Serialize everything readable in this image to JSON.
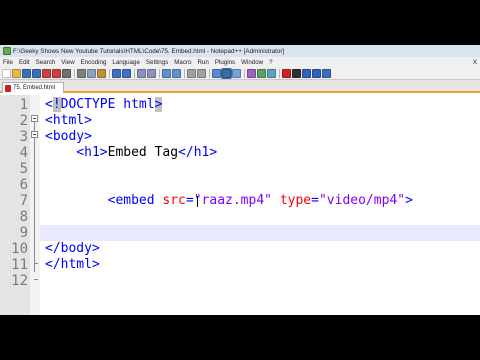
{
  "window": {
    "title": "F:\\Geeky Shows New Youtube Tutorials\\HTML\\Code\\75. Embed.html - Notepad++ [Administrator]"
  },
  "menu": {
    "items": [
      "File",
      "Edit",
      "Search",
      "View",
      "Encoding",
      "Language",
      "Settings",
      "Macro",
      "Run",
      "Plugins",
      "Window",
      "?"
    ],
    "close_label": "X"
  },
  "tabs": [
    {
      "label": "75. Embed.html",
      "active": true
    }
  ],
  "editor": {
    "current_line": 9,
    "lines": [
      {
        "num": "1",
        "parts": [
          {
            "t": "<",
            "c": "tag"
          },
          {
            "t": "!",
            "c": "tag-hl"
          },
          {
            "t": "DOCTYPE html",
            "c": "tag"
          },
          {
            "t": ">",
            "c": "tag-hl"
          }
        ]
      },
      {
        "num": "2",
        "parts": [
          {
            "t": "<html>",
            "c": "tag"
          }
        ]
      },
      {
        "num": "3",
        "parts": [
          {
            "t": "<body>",
            "c": "tag"
          }
        ]
      },
      {
        "num": "4",
        "parts": [
          {
            "t": "    <h1>",
            "c": "tag"
          },
          {
            "t": "Embed Tag",
            "c": "text"
          },
          {
            "t": "</h1>",
            "c": "tag"
          }
        ]
      },
      {
        "num": "5",
        "parts": []
      },
      {
        "num": "6",
        "parts": []
      },
      {
        "num": "7",
        "parts": [
          {
            "t": "        <embed ",
            "c": "tag"
          },
          {
            "t": "src",
            "c": "attr"
          },
          {
            "t": "=",
            "c": "tag"
          },
          {
            "t": "\"raaz.mp4\"",
            "c": "str"
          },
          {
            "t": " ",
            "c": "tag"
          },
          {
            "t": "type",
            "c": "attr"
          },
          {
            "t": "=",
            "c": "tag"
          },
          {
            "t": "\"video/mp4\"",
            "c": "str"
          },
          {
            "t": ">",
            "c": "tag"
          }
        ]
      },
      {
        "num": "8",
        "parts": []
      },
      {
        "num": "9",
        "parts": []
      },
      {
        "num": "10",
        "parts": [
          {
            "t": "</body>",
            "c": "tag"
          }
        ]
      },
      {
        "num": "11",
        "parts": [
          {
            "t": "</html>",
            "c": "tag"
          }
        ]
      },
      {
        "num": "12",
        "parts": []
      }
    ]
  },
  "toolbar": {
    "buttons": [
      {
        "icon": "new-file-icon",
        "color": "#ffffff"
      },
      {
        "icon": "open-file-icon",
        "color": "#e8b84a"
      },
      {
        "icon": "save-icon",
        "color": "#3b6fb6"
      },
      {
        "icon": "save-all-icon",
        "color": "#3b6fb6"
      },
      {
        "icon": "close-icon",
        "color": "#d04040"
      },
      {
        "icon": "close-all-icon",
        "color": "#d04040"
      },
      {
        "icon": "print-icon",
        "color": "#707070"
      },
      {
        "sep": true
      },
      {
        "icon": "cut-icon",
        "color": "#808080"
      },
      {
        "icon": "copy-icon",
        "color": "#8aa0c0"
      },
      {
        "icon": "paste-icon",
        "color": "#c09040"
      },
      {
        "sep": true
      },
      {
        "icon": "undo-icon",
        "color": "#4070c0"
      },
      {
        "icon": "redo-icon",
        "color": "#4070c0"
      },
      {
        "sep": true
      },
      {
        "icon": "find-icon",
        "color": "#9090c0"
      },
      {
        "icon": "replace-icon",
        "color": "#9090c0"
      },
      {
        "sep": true
      },
      {
        "icon": "zoom-in-icon",
        "color": "#6090d0"
      },
      {
        "icon": "zoom-out-icon",
        "color": "#6090d0"
      },
      {
        "sep": true
      },
      {
        "icon": "sync-vertical-icon",
        "color": "#a0a0a0"
      },
      {
        "icon": "sync-horizontal-icon",
        "color": "#a0a0a0"
      },
      {
        "sep": true
      },
      {
        "icon": "word-wrap-icon",
        "color": "#5a8ad0"
      },
      {
        "icon": "show-all-chars-icon",
        "color": "#3a6ea5",
        "active": true
      },
      {
        "icon": "indent-guide-icon",
        "color": "#7aa0d8"
      },
      {
        "sep": true
      },
      {
        "icon": "udl-icon",
        "color": "#a060c0"
      },
      {
        "icon": "doc-map-icon",
        "color": "#60a060"
      },
      {
        "icon": "function-list-icon",
        "color": "#60a0c0"
      },
      {
        "sep": true
      },
      {
        "icon": "record-macro-icon",
        "color": "#d02020"
      },
      {
        "icon": "stop-record-icon",
        "color": "#303030"
      },
      {
        "icon": "play-macro-icon",
        "color": "#3060c0"
      },
      {
        "icon": "run-macro-multiple-icon",
        "color": "#3060c0"
      },
      {
        "icon": "save-macro-icon",
        "color": "#3b6fb6"
      }
    ]
  }
}
